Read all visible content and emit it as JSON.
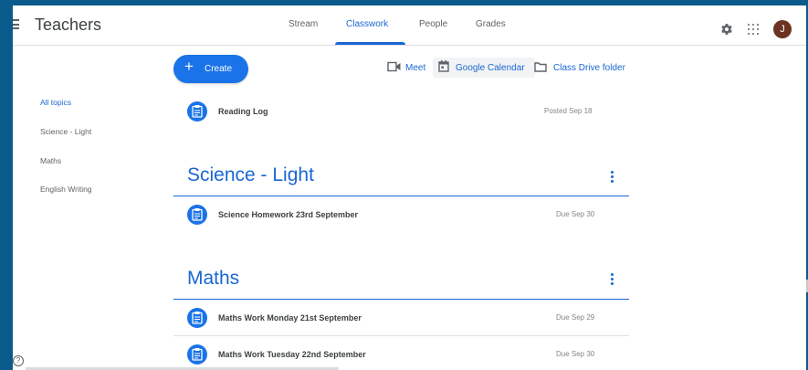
{
  "header": {
    "title": "Teachers",
    "tabs": [
      {
        "label": "Stream"
      },
      {
        "label": "Classwork"
      },
      {
        "label": "People"
      },
      {
        "label": "Grades"
      }
    ],
    "active_tab": "Classwork",
    "avatar_initial": "J"
  },
  "toolbar": {
    "create_label": "Create",
    "meet_label": "Meet",
    "calendar_label": "Google Calendar",
    "drive_label": "Class Drive folder"
  },
  "topics": [
    {
      "label": "All topics"
    },
    {
      "label": "Science - Light"
    },
    {
      "label": "Maths"
    },
    {
      "label": "English Writing"
    }
  ],
  "ungrouped": [
    {
      "title": "Reading Log",
      "date": "Posted Sep 18"
    }
  ],
  "sections": [
    {
      "title": "Science - Light",
      "items": [
        {
          "title": "Science Homework 23rd September",
          "date": "Due Sep 30"
        }
      ]
    },
    {
      "title": "Maths",
      "items": [
        {
          "title": "Maths Work Monday 21st September",
          "date": "Due Sep 29"
        },
        {
          "title": "Maths Work Tuesday 22nd September",
          "date": "Due Sep 30"
        }
      ]
    }
  ],
  "colors": {
    "accent": "#1967d2",
    "primary_button": "#1a73e8",
    "frame": "#0b5a8c",
    "avatar": "#6b3320"
  },
  "icons": {
    "menu": "menu-icon",
    "settings": "gear-icon",
    "apps": "apps-grid-icon",
    "assignment": "assignment-icon",
    "more": "more-vert-icon",
    "help": "help-icon"
  }
}
